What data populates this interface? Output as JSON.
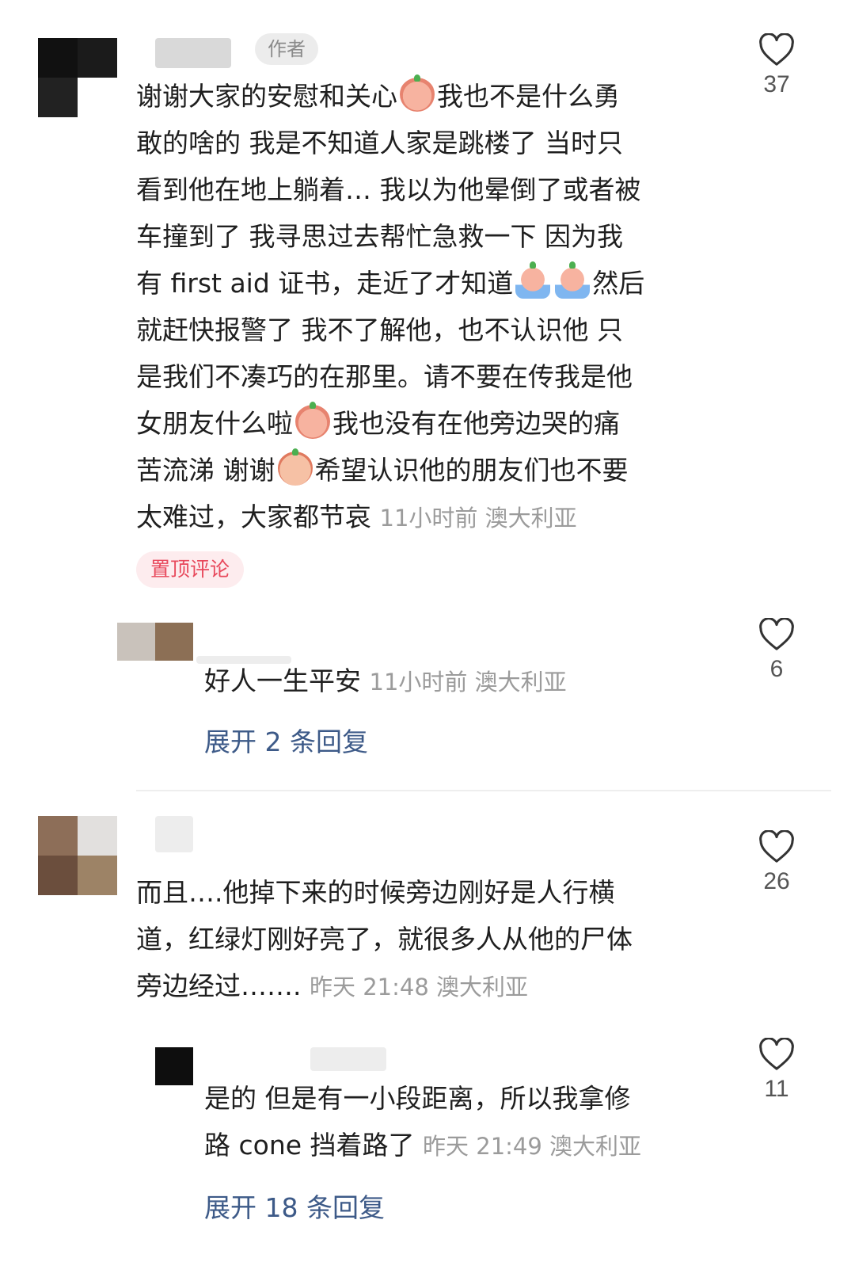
{
  "comments": [
    {
      "author_tag": "作者",
      "text_lines": [
        [
          "谢谢大家的安慰和关心",
          "我也不是什么勇"
        ],
        "敢的啥的 我是不知道人家是跳楼了 当时只",
        "看到他在地上躺着… 我以为他晕倒了或者被",
        "车撞到了 我寻思过去帮忙急救一下 因为我",
        [
          "有 first aid 证书，走近了才知道",
          "然后"
        ],
        "就赶快报警了 我不了解他，也不认识他 只",
        "是我们不凑巧的在那里。请不要在传我是他",
        [
          "女朋友什么啦",
          "我也没有在他旁边哭的痛"
        ],
        [
          "苦流涕 谢谢",
          "希望认识他的朋友们也不要"
        ],
        "太难过，大家都节哀"
      ],
      "meta": "11小时前 澳大利亚",
      "pin_label": "置顶评论",
      "likes": "37",
      "reply": {
        "text": "好人一生平安",
        "meta": "11小时前 澳大利亚",
        "likes": "6",
        "expand": "展开 2 条回复"
      }
    },
    {
      "text_lines": [
        "而且….他掉下来的时候旁边刚好是人行横",
        "道，红绿灯刚好亮了，就很多人从他的尸体",
        "旁边经过……."
      ],
      "meta": "昨天 21:48 澳大利亚",
      "likes": "26",
      "reply": {
        "text_lines": [
          "是的 但是有一小段距离，所以我拿修",
          "路 cone 挡着路了"
        ],
        "meta": "昨天 21:49 澳大利亚",
        "likes": "11",
        "expand": "展开 18 条回复"
      }
    }
  ],
  "icons": {
    "like": "heart-outline-icon",
    "emoji_1": "scared-peach-emoji-icon",
    "emoji_2": "crying-peach-emoji-icon",
    "emoji_3": "grumpy-emoji-icon"
  },
  "colors": {
    "link": "#3d5a88",
    "pin_text": "#e8495c",
    "pin_bg": "#fdecee",
    "meta": "#9b9b9b"
  }
}
